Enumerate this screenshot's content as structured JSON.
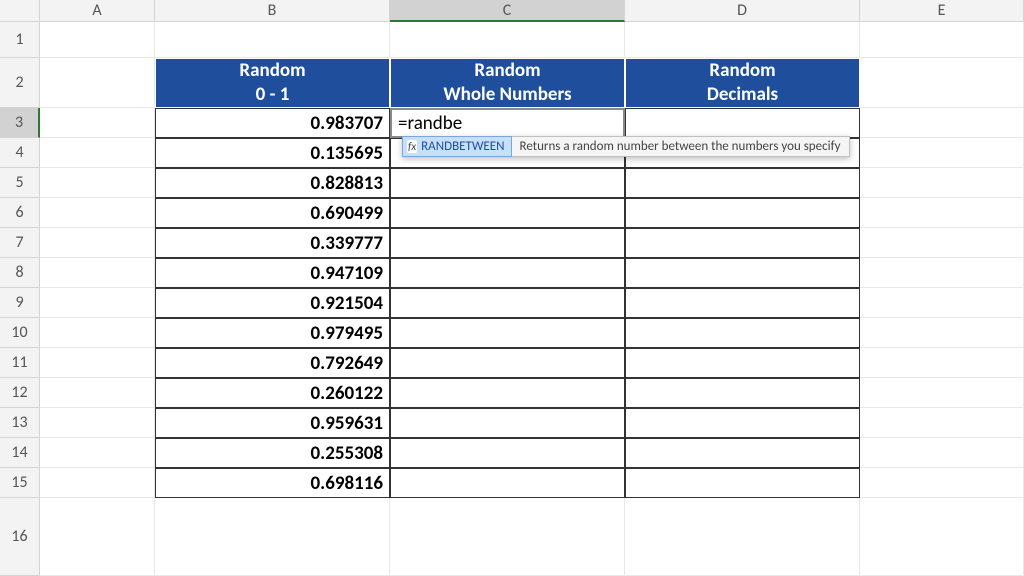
{
  "columns": [
    "A",
    "B",
    "C",
    "D",
    "E"
  ],
  "rows": [
    "1",
    "2",
    "3",
    "4",
    "5",
    "6",
    "7",
    "8",
    "9",
    "10",
    "11",
    "12",
    "13",
    "14",
    "15",
    "16"
  ],
  "active": {
    "col": "C",
    "row": "3"
  },
  "headers": {
    "b1": "Random",
    "b2": "0 - 1",
    "c1": "Random",
    "c2": "Whole Numbers",
    "d1": "Random",
    "d2": "Decimals"
  },
  "formula_input": "=randbe",
  "autocomplete": {
    "fn": "RANDBETWEEN",
    "desc": "Returns a random number between the numbers you specify"
  },
  "chart_data": {
    "type": "table",
    "columns": [
      "Random 0 - 1",
      "Random Whole Numbers",
      "Random Decimals"
    ],
    "rows": [
      {
        "r0_1": 0.983707,
        "whole": null,
        "dec": null
      },
      {
        "r0_1": 0.135695,
        "whole": null,
        "dec": null
      },
      {
        "r0_1": 0.828813,
        "whole": null,
        "dec": null
      },
      {
        "r0_1": 0.690499,
        "whole": null,
        "dec": null
      },
      {
        "r0_1": 0.339777,
        "whole": null,
        "dec": null
      },
      {
        "r0_1": 0.947109,
        "whole": null,
        "dec": null
      },
      {
        "r0_1": 0.921504,
        "whole": null,
        "dec": null
      },
      {
        "r0_1": 0.979495,
        "whole": null,
        "dec": null
      },
      {
        "r0_1": 0.792649,
        "whole": null,
        "dec": null
      },
      {
        "r0_1": 0.260122,
        "whole": null,
        "dec": null
      },
      {
        "r0_1": 0.959631,
        "whole": null,
        "dec": null
      },
      {
        "r0_1": 0.255308,
        "whole": null,
        "dec": null
      },
      {
        "r0_1": 0.698116,
        "whole": null,
        "dec": null
      }
    ]
  }
}
